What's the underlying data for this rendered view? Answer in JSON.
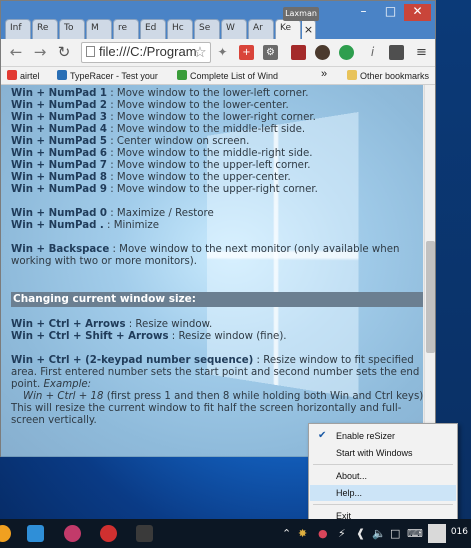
{
  "browser": {
    "profile_name": "Laxman",
    "tabs": [
      "Inf",
      "Re",
      "To",
      "M",
      "re",
      "Ed",
      "Hc",
      "Se",
      "W",
      "Ar",
      "Ke"
    ],
    "close_tab_glyph": "×",
    "window_buttons": {
      "minimize": "–",
      "maximize": "□",
      "close": "✕"
    },
    "address": "file:///C:/Program",
    "bookmarks": [
      "airtel",
      "TypeRacer - Test your",
      "Complete List of Wind"
    ],
    "bookmarks_more": "»",
    "other_bookmarks": "Other bookmarks"
  },
  "page": {
    "numpad_lines": [
      {
        "key": "Win + NumPad 1",
        "desc": " : Move window to the lower-left corner."
      },
      {
        "key": "Win + NumPad 2",
        "desc": " : Move window to the lower-center."
      },
      {
        "key": "Win + NumPad 3",
        "desc": " : Move window to the lower-right corner."
      },
      {
        "key": "Win + NumPad 4",
        "desc": " : Move window to the middle-left side."
      },
      {
        "key": "Win + NumPad 5",
        "desc": " : Center window on screen."
      },
      {
        "key": "Win + NumPad 6",
        "desc": " : Move window to the middle-right side."
      },
      {
        "key": "Win + NumPad 7",
        "desc": " : Move window to the upper-left corner."
      },
      {
        "key": "Win + NumPad 8",
        "desc": " : Move window to the upper-center."
      },
      {
        "key": "Win + NumPad 9",
        "desc": " : Move window to the upper-right corner."
      }
    ],
    "numpad0": {
      "key": "Win + NumPad 0",
      "desc": " :  Maximize / Restore"
    },
    "numpaddot": {
      "key": "Win + NumPad .",
      "desc": " :  Minimize"
    },
    "backspace": {
      "key": "Win + Backspace",
      "desc": " : Move window to the next monitor (only available when working with two or more monitors)."
    },
    "section_title": "Changing current window size:",
    "arrows": {
      "key": "Win + Ctrl + Arrows",
      "desc": " : Resize window."
    },
    "shift_arrows": {
      "key": "Win + Ctrl + Shift + Arrows",
      "desc": " : Resize window (fine)."
    },
    "keypad_seq": {
      "key": "Win + Ctrl + (2-keypad number sequence)",
      "desc": " : Resize window to fit specified area. First entered number sets the start point and second number sets the end point.",
      "example_label": "Example:",
      "example_keys": "Win + Ctrl + 18",
      "example_note": "  (first press 1 and then 8 while holding both Win and Ctrl keys) :",
      "example_result": "This will resize the current window to fit half the screen horizontally and full-screen vertically."
    }
  },
  "tray_menu": {
    "items": [
      "Enable reSizer",
      "Start with Windows",
      "About...",
      "Help...",
      "Exit"
    ],
    "checked": "Enable reSizer",
    "highlighted": "Help..."
  },
  "taskbar": {
    "clock_fragment": "016"
  },
  "colors": {
    "titlebar": "#4a83c6",
    "section_head": "#6b7f91",
    "menu_highlight": "#cce4f7",
    "taskbar": "#0c1724"
  }
}
